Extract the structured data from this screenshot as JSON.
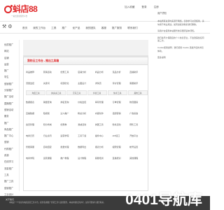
{
  "header": {
    "logo_text": "蚪店88",
    "logo_sub": "一站式优化服务平台",
    "top_links": [
      "加入收藏",
      "登录",
      "注册"
    ]
  },
  "nav": {
    "items": [
      "首页",
      "我的工作台",
      "工具",
      "推广",
      "优产品",
      "我的团队",
      "客服",
      "推广服务",
      "联系我们"
    ]
  },
  "sidebar": {
    "items": [
      "优质推广",
      "网站",
      "店铺",
      "运营",
      "推广",
      "学生",
      "营销推广",
      "分销推广",
      "推广活动",
      "直播推广",
      "营销活动",
      "服务",
      "推广",
      "商品推广",
      "推广中心",
      "营销",
      "代购推广",
      "资源",
      "在线学习",
      "流量推广",
      "工具",
      "推广工具",
      "营销推广",
      "工业设计"
    ]
  },
  "panel": {
    "title": "我的云工作台 - 推出工具箱",
    "tabs": [
      "淘宝工具",
      "拼多多工具",
      "京东工具",
      "抖音工具",
      "快手工具",
      "其他工具"
    ],
    "rows": [
      [
        "商品推荐",
        "营销活动",
        "优惠工具",
        "店铺分析",
        "商品分析",
        "竞品分析",
        "直播助手"
      ],
      [
        "流量监控",
        "关键词",
        "标题优化",
        "主图设计",
        "详情页",
        "评价管理",
        "客服助手"
      ],
      [
        "数据报表",
        "销量查询",
        "排名查询",
        "价格监控",
        "库存管理",
        "订单管理",
        "物流跟踪"
      ],
      [
        "直播数据",
        "短视频",
        "达人推广",
        "粉丝分析",
        "内容创作",
        "话题营销",
        "广告投放"
      ],
      [
        "会员管理",
        "积分商城",
        "优惠券",
        "满减活动",
        "拼团工具",
        "秒杀活动",
        "预售工具"
      ],
      [
        "电商日历",
        "行业资讯",
        "运营学院",
        "工具下载",
        "插件中心",
        "API接口",
        "开放平台"
      ],
      [
        "智能客服",
        "自动回复",
        "批量处理",
        "数据导出",
        "报表分析",
        "权限管理",
        "帐号设置"
      ],
      [
        "电商学院",
        "运营课程",
        "推广教程",
        "设计教程",
        "客服培训",
        "直播培训",
        "其他课程"
      ]
    ]
  },
  "side": {
    "title": "用户须知",
    "paragraphs": [
      "本站所有资源均来源于网络，仅供学习交流使用，请勿用于商业用途。如有侵权请联系我们删除。",
      "请用户在使用本站服务前仔细阅读本须知。",
      "我们会尽力保障您的个人信息安全，不会泄露给任何第三方。",
      "Cookie使用说明：我们使用 Cookie 来提升您的浏览体验。",
      "更多说明"
    ]
  },
  "footer": {
    "title": "关于我们",
    "text": "　　本站是一个专业的电商运营工具平台，提供各类推广营销工具与运营服务。本站内容仅供参考，如有问题请与我们联系。"
  },
  "watermark": "0401导航库",
  "colors": {
    "accent": "#e0282a",
    "footer_bg": "#3b3b3b"
  }
}
